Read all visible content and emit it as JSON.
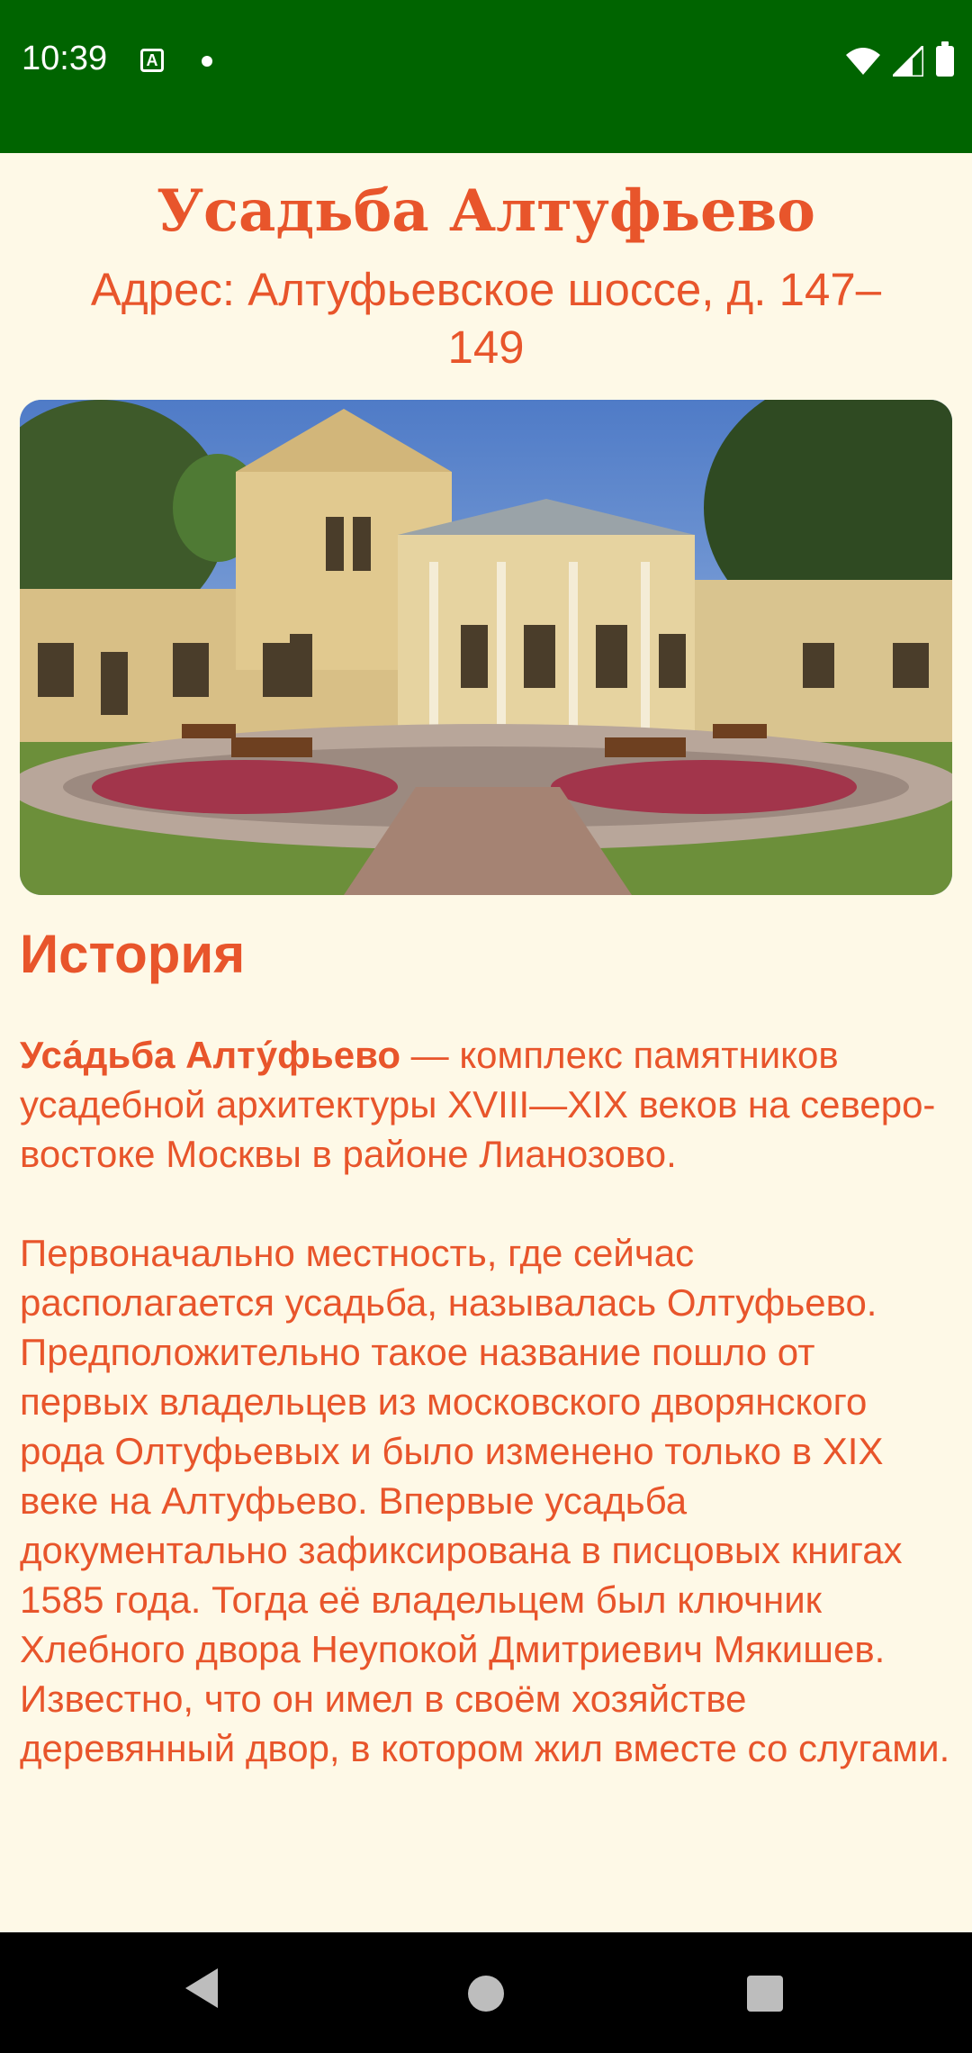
{
  "status_bar": {
    "time": "10:39",
    "notification_icon": "A",
    "icons": [
      "wifi-icon",
      "signal-icon",
      "battery-icon"
    ]
  },
  "page": {
    "title": "Усадьба Алтуфьево",
    "address": "Адрес: Алтуфьевское шоссе, д. 147–149",
    "image": "estate-photo",
    "history_heading": "История",
    "intro_bold": "Уса́дьба Алту́фьево",
    "intro_rest": " — комплекс памятников усадебной архитектуры XVIII—XIX веков на северо-востоке Москвы в районе Лианозово.",
    "paragraph2": "Первоначально местность, где сейчас располагается усадьба, называлась Олтуфьево. Предположительно такое название пошло от первых владельцев из московского дворянского рода Олтуфьевых и было изменено только в XIX веке на Алтуфьево. Впервые усадьба документально зафиксирована в писцовых книгах 1585 года. Тогда её владельцем был ключник Хлебного двора Неупокой Дмитриевич Мякишев. Известно, что он имел в своём хозяйстве деревянный двор, в котором жил вместе со слугами."
  },
  "navigation": {
    "buttons": [
      "back-button",
      "home-button",
      "recents-button"
    ]
  },
  "colors": {
    "status_bar": "#006400",
    "background": "#fef9e7",
    "text": "#e8552b"
  }
}
